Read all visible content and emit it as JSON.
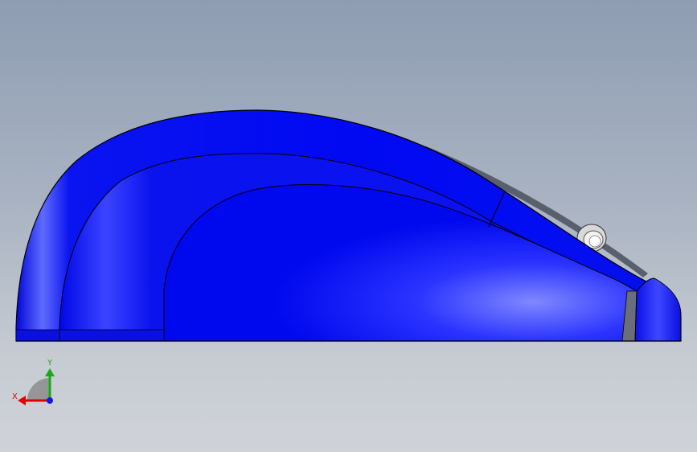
{
  "viewport": {
    "background_top": "#8e9db3",
    "background_bottom": "#cfd3d8",
    "model_color": "#0a0ff5",
    "model_highlight": "#7f86ff",
    "edge_color": "#000000",
    "gap_color": "#6a6e7a"
  },
  "triad": {
    "x_label": "X",
    "y_label": "Y",
    "x_color": "#e00000",
    "y_color": "#1aa81a",
    "z_color": "#1616e0"
  }
}
